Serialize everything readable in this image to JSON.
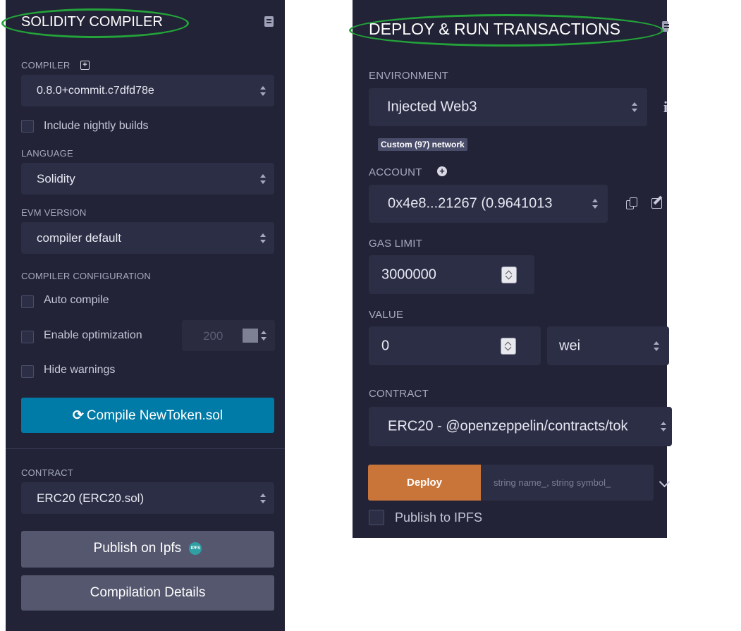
{
  "left": {
    "title": "SOLIDITY COMPILER",
    "compiler_label": "COMPILER",
    "compiler_value": "0.8.0+commit.c7dfd78e",
    "nightly_label": "Include nightly builds",
    "language_label": "LANGUAGE",
    "language_value": "Solidity",
    "evm_label": "EVM VERSION",
    "evm_value": "compiler default",
    "config_label": "COMPILER CONFIGURATION",
    "auto_compile_label": "Auto compile",
    "optimization_label": "Enable optimization",
    "optimization_runs": "200",
    "hide_warnings_label": "Hide warnings",
    "compile_button": "Compile NewToken.sol",
    "contract_label": "CONTRACT",
    "contract_value": "ERC20 (ERC20.sol)",
    "publish_button": "Publish on Ipfs",
    "ipfs_badge": "IPFS",
    "details_button": "Compilation Details"
  },
  "right": {
    "title": "DEPLOY & RUN TRANSACTIONS",
    "environment_label": "ENVIRONMENT",
    "environment_value": "Injected Web3",
    "network_badge": "Custom (97) network",
    "info_glyph": "i",
    "account_label": "ACCOUNT",
    "account_value": "0x4e8...21267 (0.9641013",
    "gas_label": "GAS LIMIT",
    "gas_value": "3000000",
    "value_label": "VALUE",
    "value_amount": "0",
    "value_unit": "wei",
    "contract_label": "CONTRACT",
    "contract_value": "ERC20 - @openzeppelin/contracts/tok",
    "deploy_button": "Deploy",
    "deploy_params_placeholder": "string name_, string symbol_",
    "publish_ipfs_label": "Publish to IPFS"
  },
  "colors": {
    "panel_bg": "#222336",
    "input_bg": "#2c2e45",
    "compile_blue": "#007aa6",
    "deploy_orange": "#c97539",
    "highlight_green": "#23a33a"
  }
}
